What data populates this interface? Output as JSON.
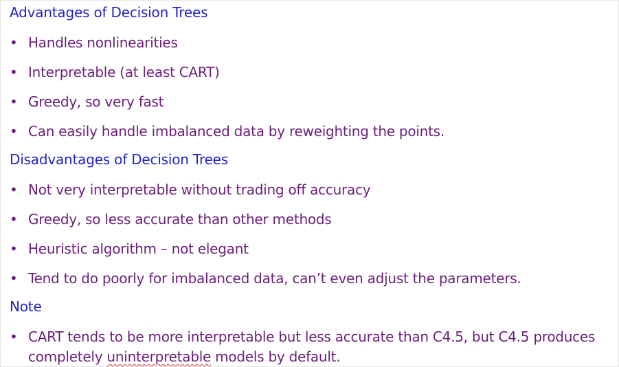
{
  "sections": [
    {
      "heading": "Advantages of Decision Trees",
      "items": [
        "Handles nonlinearities",
        "Interpretable (at least CART)",
        "Greedy, so very fast",
        "Can easily handle imbalanced data by reweighting the points."
      ]
    },
    {
      "heading": "Disadvantages of Decision Trees",
      "items": [
        "Not very interpretable without trading off accuracy",
        "Greedy, so less accurate than other methods",
        "Heuristic algorithm – not elegant",
        "Tend to do poorly for imbalanced data, can’t even adjust the parameters."
      ]
    },
    {
      "heading": "Note",
      "items": []
    }
  ],
  "note": {
    "before": "CART tends to be more interpretable but less accurate than C4.5, but C4.5 produces completely ",
    "misspelled": "uninterpretable",
    "after": " models by default."
  },
  "bullet_char": "•",
  "colors": {
    "heading": "#2323c8",
    "body_text": "#6a1f7a",
    "spellcheck_underline": "#d04040"
  }
}
